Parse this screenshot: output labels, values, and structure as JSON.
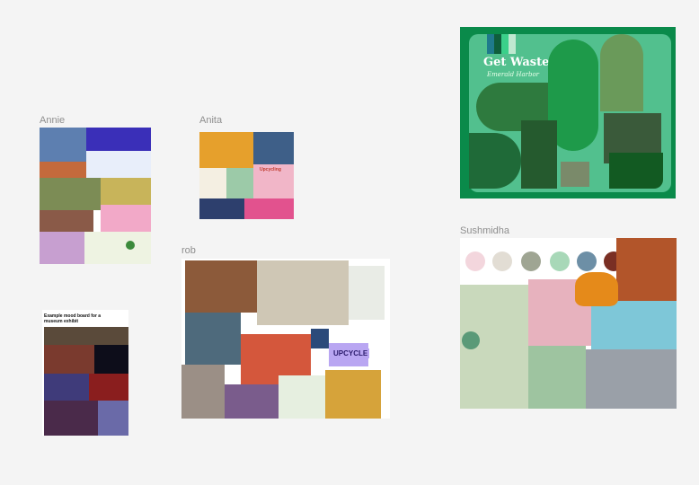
{
  "canvas": {
    "background": "#f4f4f4",
    "boards": [
      {
        "id": "annie",
        "label": "Annie"
      },
      {
        "id": "anita",
        "label": "Anita",
        "image_text": "Upcycling"
      },
      {
        "id": "rob",
        "label": "rob",
        "image_text": "UPCYCLE"
      },
      {
        "id": "museum",
        "label": "",
        "caption": "Example mood board for a museum exhibit"
      },
      {
        "id": "get-wasted",
        "label": "",
        "title": "Get Wasted",
        "subtitle": "Emerald Harbor",
        "accent": "#0a8a4a"
      },
      {
        "id": "sushmidha",
        "label": "Sushmidha",
        "palette": [
          "#f3d6dd",
          "#e2ddd4",
          "#9fa593",
          "#a8d8b8",
          "#6d8fa6",
          "#7a2f24",
          "#e39a6a"
        ]
      }
    ]
  }
}
